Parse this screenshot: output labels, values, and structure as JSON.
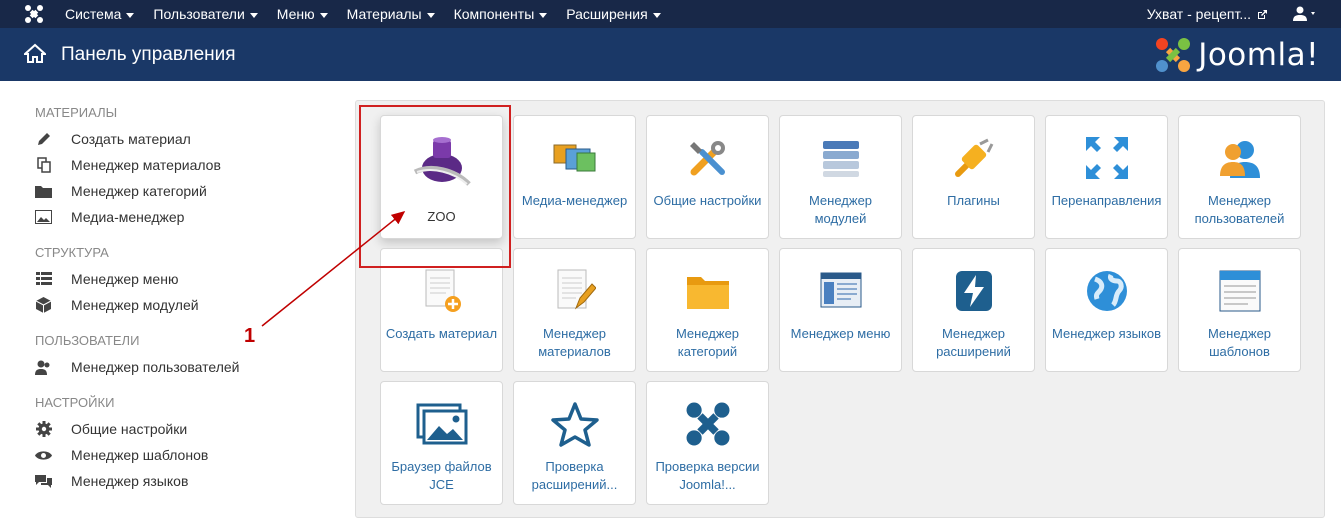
{
  "topnav": {
    "menu": [
      "Система",
      "Пользователи",
      "Меню",
      "Материалы",
      "Компоненты",
      "Расширения"
    ],
    "site_label": "Ухват - рецепт..."
  },
  "titlebar": {
    "title": "Панель управления",
    "brand": "Joomla!"
  },
  "sidebar": {
    "sections": [
      {
        "header": "МАТЕРИАЛЫ",
        "items": [
          "Создать материал",
          "Менеджер материалов",
          "Менеджер категорий",
          "Медиа-менеджер"
        ]
      },
      {
        "header": "СТРУКТУРА",
        "items": [
          "Менеджер меню",
          "Менеджер модулей"
        ]
      },
      {
        "header": "ПОЛЬЗОВАТЕЛИ",
        "items": [
          "Менеджер пользователей"
        ]
      },
      {
        "header": "НАСТРОЙКИ",
        "items": [
          "Общие настройки",
          "Менеджер шаблонов",
          "Менеджер языков"
        ]
      }
    ]
  },
  "tiles": [
    [
      "ZOO",
      "Медиа-менеджер",
      "Общие настройки",
      "Менеджер модулей",
      "Плагины",
      "Перенаправления",
      "Менеджер пользователей"
    ],
    [
      "Создать материал",
      "Менеджер материалов",
      "Менеджер категорий",
      "Менеджер меню",
      "Менеджер расширений",
      "Менеджер языков",
      "Менеджер шаблонов"
    ],
    [
      "Браузер файлов JCE",
      "Проверка расширений...",
      "Проверка версии Joomla!..."
    ]
  ],
  "annotation": "1",
  "colors": {
    "topnav": "#182848",
    "titlebar": "#1a3867",
    "link": "#2e6da4",
    "highlight": "#d02020"
  }
}
